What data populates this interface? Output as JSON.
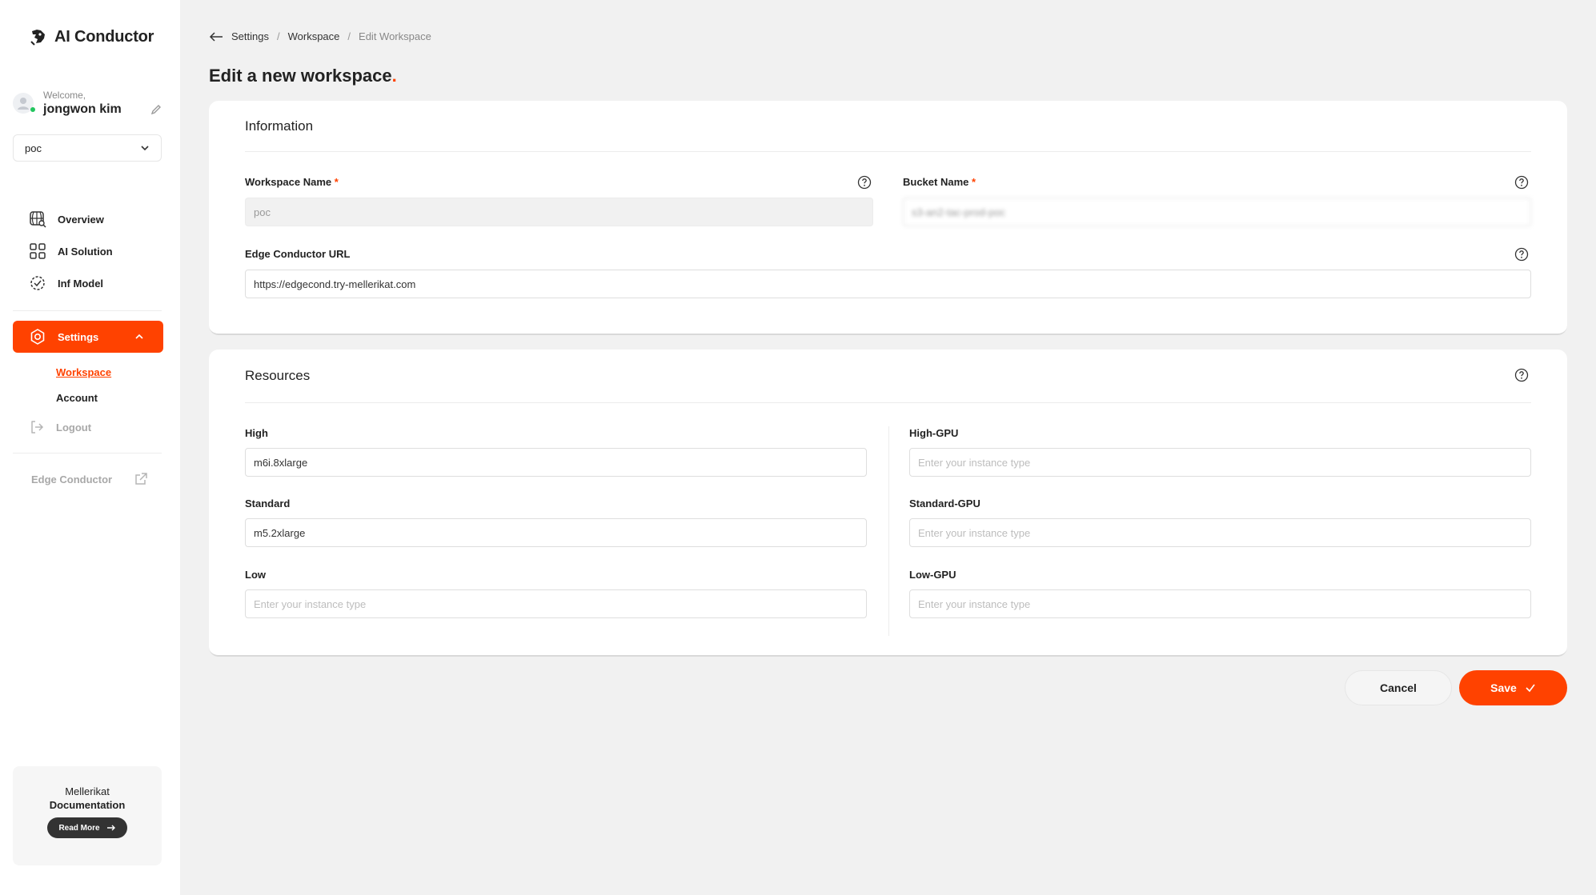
{
  "app": {
    "name": "AI Conductor"
  },
  "user": {
    "welcome": "Welcome,",
    "name": "jongwon kim"
  },
  "workspace_select": {
    "value": "poc"
  },
  "nav": {
    "overview": "Overview",
    "ai_solution": "AI Solution",
    "inf_model": "Inf Model",
    "settings": "Settings",
    "workspace": "Workspace",
    "account": "Account",
    "logout": "Logout",
    "edge_conductor": "Edge Conductor"
  },
  "doc_card": {
    "line1": "Mellerikat",
    "line2": "Documentation",
    "button": "Read More"
  },
  "breadcrumb": {
    "item1": "Settings",
    "item2": "Workspace",
    "current": "Edit Workspace"
  },
  "page": {
    "title": "Edit a new workspace",
    "title_dot": "."
  },
  "information": {
    "title": "Information",
    "workspace_name_label": "Workspace Name",
    "workspace_name_value": "poc",
    "bucket_name_label": "Bucket Name",
    "bucket_name_value": "s3-an2-tac-prod-poc",
    "edge_url_label": "Edge Conductor URL",
    "edge_url_value": "https://edgecond.try-mellerikat.com",
    "required_mark": "*"
  },
  "resources": {
    "title": "Resources",
    "placeholder": "Enter your instance type",
    "fields": {
      "high": {
        "label": "High",
        "value": "m6i.8xlarge"
      },
      "standard": {
        "label": "Standard",
        "value": "m5.2xlarge"
      },
      "low": {
        "label": "Low",
        "value": ""
      },
      "high_gpu": {
        "label": "High-GPU",
        "value": ""
      },
      "standard_gpu": {
        "label": "Standard-GPU",
        "value": ""
      },
      "low_gpu": {
        "label": "Low-GPU",
        "value": ""
      }
    }
  },
  "actions": {
    "cancel": "Cancel",
    "save": "Save"
  },
  "colors": {
    "accent": "#ff4200",
    "background": "#f1f1f1",
    "online": "#22c55e"
  },
  "icons": [
    "back-arrow-icon",
    "help-icon",
    "globe-icon",
    "grid-icon",
    "model-icon",
    "gear-icon",
    "logout-icon",
    "external-link-icon",
    "check-icon",
    "chevron-down-icon",
    "pencil-icon",
    "logo-icon",
    "arrow-right-icon"
  ]
}
